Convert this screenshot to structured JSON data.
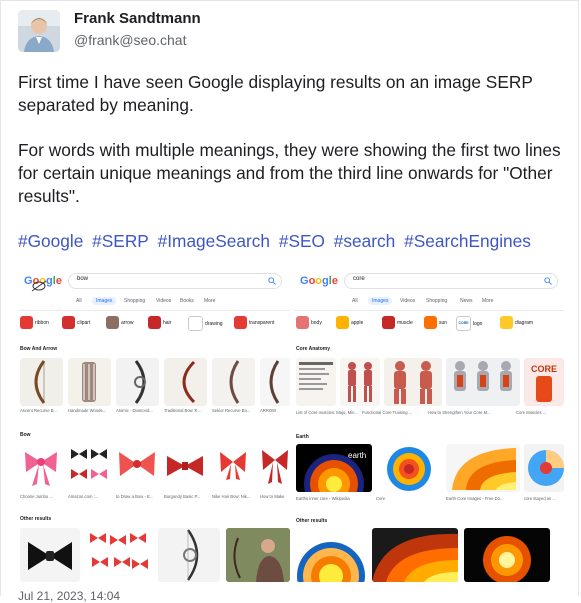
{
  "author": {
    "name": "Frank Sandtmann",
    "handle": "@frank@seo.chat"
  },
  "post": {
    "paragraph1": "First time I have seen Google displaying results on an image SERP separated by meaning.",
    "paragraph2": "For words with multiple meanings, they were showing the first two lines for certain unique meanings and from the third line onwards for \"Other results\".",
    "hashtags": [
      "#Google",
      "#SERP",
      "#ImageSearch",
      "#SEO",
      "#search",
      "#SearchEngines"
    ]
  },
  "screenshot_left": {
    "logo": "Google",
    "query": "bow",
    "tabs": [
      "All",
      "Images",
      "Shopping",
      "Videos",
      "Books",
      "More"
    ],
    "chips": [
      "ribbon",
      "clipart",
      "arrow",
      "hair",
      "drawing",
      "transparent"
    ],
    "sections": [
      "Bow And Arrow",
      "Bow",
      "Other results"
    ],
    "row1_captions": [
      "Ascent Recurve B...",
      "Handmade Woode...",
      "Atomic - Diamond...",
      "Traditional Bow 'K...",
      "Sekior Recurve Bo...",
      "ARROW"
    ],
    "row2_captions": [
      "Choose Jumbo ...",
      "Amazon.com :...",
      "to Draw a Bow - E...",
      "Burgundy Basic P...",
      "Nike Hair Bow: Nik...",
      "How to Make"
    ]
  },
  "screenshot_right": {
    "logo": "Google",
    "query": "core",
    "tabs": [
      "All",
      "Images",
      "Videos",
      "Shopping",
      "News",
      "More"
    ],
    "chips": [
      "body",
      "apple",
      "muscle",
      "sun",
      "logo",
      "diagram"
    ],
    "chip_logo_text": "CORE",
    "sections": [
      "Core Anatomy",
      "Earth",
      "Other results"
    ],
    "row1_captions": [
      "List of Core muscles: Majo, Min...",
      "Functional Core Training ...",
      "How to Strengthen Your Core M...",
      "Core Muscles ..."
    ],
    "row2_captions": [
      "Earths inner core - Wikipedia",
      "Core",
      "Earth Core Images - Free Do...",
      "core stayed as ..."
    ],
    "thumb_text_core": "CORE",
    "thumb_text_earth": "earth"
  },
  "footer": {
    "timestamp": "Jul 21, 2023, 14:04"
  },
  "colors": {
    "hashtag": "#3e56c5",
    "text": "#1c1e21",
    "muted": "#5f6368",
    "google_blue": "#4285f4",
    "google_red": "#ea4335",
    "google_yellow": "#fbbc05",
    "google_green": "#34a853"
  }
}
